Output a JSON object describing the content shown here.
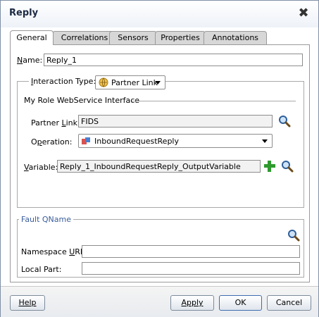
{
  "dialog": {
    "title": "Reply"
  },
  "tabs": [
    {
      "label": "General",
      "active": true
    },
    {
      "label": "Correlations",
      "active": false
    },
    {
      "label": "Sensors",
      "active": false
    },
    {
      "label": "Properties",
      "active": false
    },
    {
      "label": "Annotations",
      "active": false
    }
  ],
  "general": {
    "name_label": "Name:",
    "name_value": "Reply_1",
    "interaction_type_label": "Interaction Type:",
    "interaction_type_value": "Partner Link",
    "my_role_label": "My Role WebService Interface",
    "partner_link_label": "Partner Link:",
    "partner_link_value": "FIDS",
    "operation_label": "Operation:",
    "operation_value": "InboundRequestReply",
    "variable_label": "Variable:",
    "variable_value": "Reply_1_InboundRequestReply_OutputVariable"
  },
  "fault_qname": {
    "legend": "Fault QName",
    "namespace_uri_label": "Namespace URI:",
    "namespace_uri_value": "",
    "local_part_label": "Local Part:",
    "local_part_value": ""
  },
  "buttons": {
    "help": "Help",
    "apply": "Apply",
    "ok": "OK",
    "cancel": "Cancel"
  },
  "icons": {
    "close": "close-x-icon",
    "search": "magnifier-icon",
    "add": "green-plus-icon",
    "partner_link": "partner-link-globe-icon",
    "operation": "operation-icon"
  },
  "colors": {
    "title_text": "#1c2a44",
    "fault_legend": "#3a5d9c",
    "add_green": "#2e9a2e"
  }
}
